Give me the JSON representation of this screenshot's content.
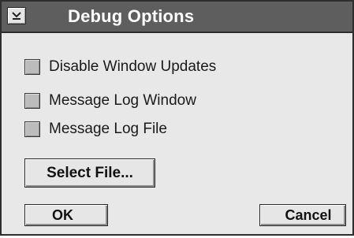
{
  "window": {
    "title": "Debug Options",
    "menu_icon": "window-menu-arrow-icon",
    "titlebar_color": "#5e5e5e"
  },
  "options": [
    {
      "label": "Disable Window Updates",
      "checked": false
    },
    {
      "label": "Message Log Window",
      "checked": false
    },
    {
      "label": "Message Log File",
      "checked": false
    }
  ],
  "buttons": {
    "select_file": "Select File...",
    "ok": "OK",
    "cancel": "Cancel"
  }
}
